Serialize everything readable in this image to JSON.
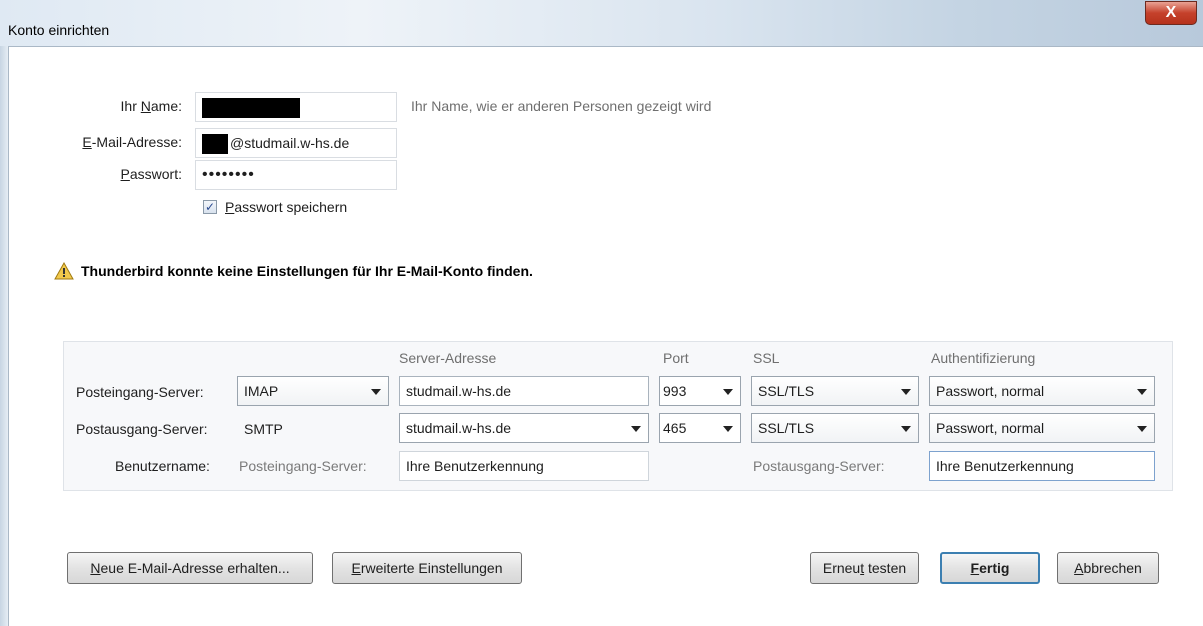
{
  "window": {
    "title": "Konto einrichten",
    "close_label": "X"
  },
  "form": {
    "name_label_pre": "Ihr ",
    "name_label_key": "N",
    "name_label_post": "ame:",
    "name_hint": "Ihr Name, wie er anderen Personen gezeigt wird",
    "email_label_key": "E",
    "email_label_post": "-Mail-Adresse:",
    "email_value_suffix": "@studmail.w-hs.de",
    "password_label_key": "P",
    "password_label_post": "asswort:",
    "password_value": "••••••••",
    "remember_checked": true,
    "remember_key": "P",
    "remember_label_post": "asswort speichern"
  },
  "warning": {
    "icon": "warning-triangle-icon",
    "text": "Thunderbird konnte keine Einstellungen für Ihr E-Mail-Konto finden."
  },
  "server_table": {
    "columns": {
      "address": "Server-Adresse",
      "port": "Port",
      "ssl": "SSL",
      "auth": "Authentifizierung"
    },
    "incoming": {
      "label": "Posteingang-Server:",
      "protocol": "IMAP",
      "address": "studmail.w-hs.de",
      "port": "993",
      "ssl": "SSL/TLS",
      "auth": "Passwort, normal"
    },
    "outgoing": {
      "label": "Postausgang-Server:",
      "protocol": "SMTP",
      "address": "studmail.w-hs.de",
      "port": "465",
      "ssl": "SSL/TLS",
      "auth": "Passwort, normal"
    },
    "username": {
      "label": "Benutzername:",
      "incoming_label": "Posteingang-Server:",
      "incoming_value": "Ihre Benutzerkennung",
      "outgoing_label": "Postausgang-Server:",
      "outgoing_value": "Ihre Benutzerkennung"
    }
  },
  "buttons": {
    "new_email_key": "N",
    "new_email_post": "eue E-Mail-Adresse erhalten...",
    "advanced_key": "E",
    "advanced_post": "rweiterte Einstellungen",
    "retest_pre": "Erneu",
    "retest_key": "t",
    "retest_post": " testen",
    "done_key": "F",
    "done_post": "ertig",
    "cancel_key": "A",
    "cancel_post": "bbrechen"
  }
}
